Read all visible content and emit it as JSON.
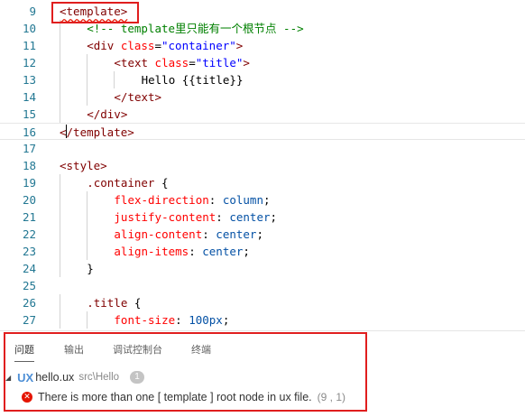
{
  "editor": {
    "lines": [
      {
        "n": "9",
        "tokens": [
          {
            "c": "t-tag squiggle",
            "t": "<template>"
          }
        ]
      },
      {
        "n": "10",
        "tokens": [
          {
            "c": "t-comment",
            "t": "<!-- template里只能有一个根节点 -->"
          }
        ]
      },
      {
        "n": "11",
        "tokens": [
          {
            "c": "t-tag",
            "t": "<div "
          },
          {
            "c": "t-attr",
            "t": "class"
          },
          {
            "c": "t-punct",
            "t": "="
          },
          {
            "c": "t-str",
            "t": "\"container\""
          },
          {
            "c": "t-tag",
            "t": ">"
          }
        ]
      },
      {
        "n": "12",
        "tokens": [
          {
            "c": "t-tag",
            "t": "<text "
          },
          {
            "c": "t-attr",
            "t": "class"
          },
          {
            "c": "t-punct",
            "t": "="
          },
          {
            "c": "t-str",
            "t": "\"title\""
          },
          {
            "c": "t-tag",
            "t": ">"
          }
        ]
      },
      {
        "n": "13",
        "tokens": [
          {
            "c": "t-text",
            "t": "Hello {{title}}"
          }
        ]
      },
      {
        "n": "14",
        "tokens": [
          {
            "c": "t-tag",
            "t": "</text>"
          }
        ]
      },
      {
        "n": "15",
        "tokens": [
          {
            "c": "t-tag",
            "t": "</div>"
          }
        ]
      },
      {
        "n": "16",
        "tokens": [
          {
            "c": "t-tag",
            "t": "</template>"
          }
        ]
      },
      {
        "n": "17",
        "tokens": []
      },
      {
        "n": "18",
        "tokens": [
          {
            "c": "t-tag",
            "t": "<style>"
          }
        ]
      },
      {
        "n": "19",
        "tokens": [
          {
            "c": "t-sel",
            "t": ".container"
          },
          {
            "c": "t-punct",
            "t": " {"
          }
        ]
      },
      {
        "n": "20",
        "tokens": [
          {
            "c": "t-prop",
            "t": "flex-direction"
          },
          {
            "c": "t-punct",
            "t": ": "
          },
          {
            "c": "t-val",
            "t": "column"
          },
          {
            "c": "t-punct",
            "t": ";"
          }
        ]
      },
      {
        "n": "21",
        "tokens": [
          {
            "c": "t-prop",
            "t": "justify-content"
          },
          {
            "c": "t-punct",
            "t": ": "
          },
          {
            "c": "t-val",
            "t": "center"
          },
          {
            "c": "t-punct",
            "t": ";"
          }
        ]
      },
      {
        "n": "22",
        "tokens": [
          {
            "c": "t-prop",
            "t": "align-content"
          },
          {
            "c": "t-punct",
            "t": ": "
          },
          {
            "c": "t-val",
            "t": "center"
          },
          {
            "c": "t-punct",
            "t": ";"
          }
        ]
      },
      {
        "n": "23",
        "tokens": [
          {
            "c": "t-prop",
            "t": "align-items"
          },
          {
            "c": "t-punct",
            "t": ": "
          },
          {
            "c": "t-val",
            "t": "center"
          },
          {
            "c": "t-punct",
            "t": ";"
          }
        ]
      },
      {
        "n": "24",
        "tokens": [
          {
            "c": "t-punct",
            "t": "}"
          }
        ]
      },
      {
        "n": "25",
        "tokens": []
      },
      {
        "n": "26",
        "tokens": [
          {
            "c": "t-sel",
            "t": ".title"
          },
          {
            "c": "t-punct",
            "t": " {"
          }
        ]
      },
      {
        "n": "27",
        "tokens": [
          {
            "c": "t-prop",
            "t": "font-size"
          },
          {
            "c": "t-punct",
            "t": ": "
          },
          {
            "c": "t-val",
            "t": "100px"
          },
          {
            "c": "t-punct",
            "t": ";"
          }
        ]
      }
    ]
  },
  "panel": {
    "tabs": [
      "问题",
      "输出",
      "调试控制台",
      "终端"
    ],
    "active_tab": "问题",
    "file": {
      "icon": "UX",
      "name": "hello.ux",
      "path": "src\\Hello",
      "count": "1"
    },
    "problem": {
      "message": "There is more than one [ template ] root node in ux file.",
      "location": "(9 , 1)"
    }
  }
}
